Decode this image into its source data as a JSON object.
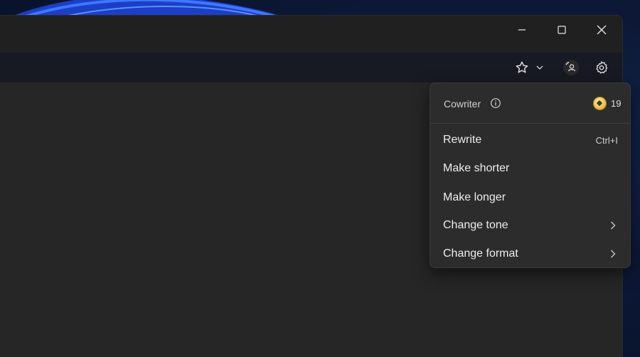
{
  "window": {
    "controls": [
      "minimize-icon",
      "maximize-icon",
      "close-icon"
    ]
  },
  "toolbar": {
    "icons": [
      "star-icon",
      "chevron-down-icon",
      "profile-icon",
      "gear-icon"
    ]
  },
  "menu": {
    "title": "Cowriter",
    "info_icon": "info-icon",
    "credits_icon": "coin-icon",
    "credits": "19",
    "items": [
      {
        "label": "Rewrite",
        "shortcut": "Ctrl+I"
      },
      {
        "label": "Make shorter"
      },
      {
        "label": "Make longer"
      },
      {
        "label": "Change tone",
        "submenu_icon": "chevron-right-icon"
      },
      {
        "label": "Change format",
        "submenu_icon": "chevron-right-icon"
      }
    ]
  },
  "colors": {
    "window_bg": "#202020",
    "content_bg": "#262626",
    "menu_bg": "#2c2c2c",
    "wallpaper_accent": "#1f5cff"
  }
}
